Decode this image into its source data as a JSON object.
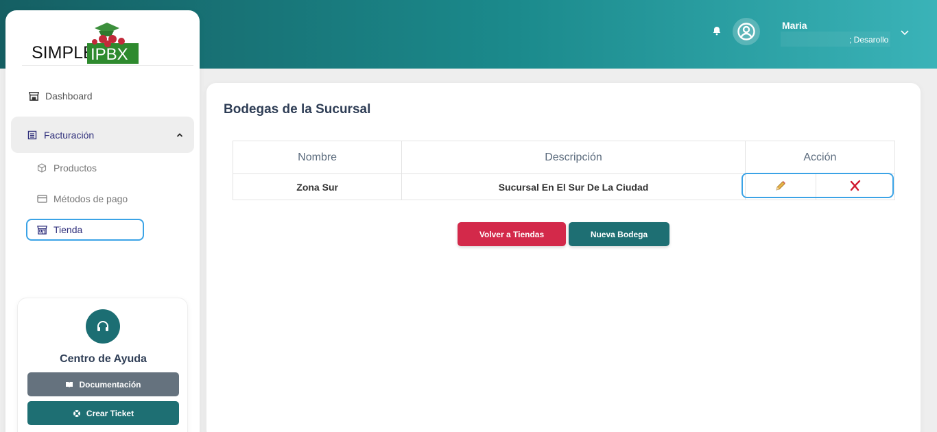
{
  "header": {
    "user_name": "Maria",
    "user_role": "; Desarollo"
  },
  "logo": {
    "text_left": "SIMPLE",
    "text_right": "IPBX"
  },
  "sidebar": {
    "items": [
      {
        "label": "Dashboard",
        "icon": "store-icon"
      },
      {
        "label": "Facturación",
        "icon": "receipt-icon"
      },
      {
        "label": "Productos",
        "icon": "box-icon"
      },
      {
        "label": "Métodos de pago",
        "icon": "credit-card-icon"
      },
      {
        "label": "Tienda",
        "icon": "shop-icon"
      }
    ]
  },
  "help": {
    "title": "Centro de Ayuda",
    "docs_label": "Documentación",
    "ticket_label": "Crear Ticket"
  },
  "main": {
    "title": "Bodegas de la Sucursal",
    "table": {
      "headers": [
        "Nombre",
        "Descripción",
        "Acción"
      ],
      "rows": [
        {
          "nombre": "Zona Sur",
          "descripcion": "Sucursal En El Sur De La Ciudad"
        }
      ]
    },
    "volver_label": "Volver a Tiendas",
    "nueva_label": "Nueva Bodega"
  },
  "colors": {
    "brand_teal": "#1e6f73",
    "danger": "#d3294a",
    "highlight": "#3ba3e6"
  }
}
